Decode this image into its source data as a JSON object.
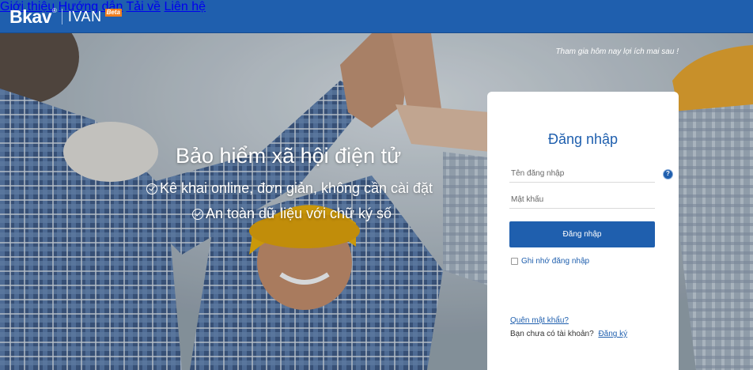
{
  "brand": {
    "logo": "Bkav",
    "registered": "®",
    "product": "IVAN",
    "badge": "Beta"
  },
  "nav": {
    "items": [
      "Giới thiệu",
      "Hướng dẫn",
      "Tải về",
      "Liên hệ"
    ]
  },
  "hero": {
    "tagline": "Tham gia hôm nay lợi ích mai sau !",
    "title": "Bảo hiểm xã hội điện tử",
    "features": [
      "Kê khai online, đơn giản, không cần cài đặt",
      "An toàn dữ liệu với chữ ký số"
    ]
  },
  "login": {
    "title": "Đăng nhập",
    "username_placeholder": "Tên đăng nhập",
    "password_placeholder": "Mật khẩu",
    "help": "?",
    "submit_label": "Đăng nhập",
    "remember_label": "Ghi nhớ đăng nhập",
    "forgot_label": "Quên mật khẩu?",
    "no_account_text": "Bạn chưa có tài khoản?",
    "signup_label": "Đăng ký"
  },
  "colors": {
    "primary": "#1f5fae",
    "beta_badge": "#f07e1d"
  }
}
